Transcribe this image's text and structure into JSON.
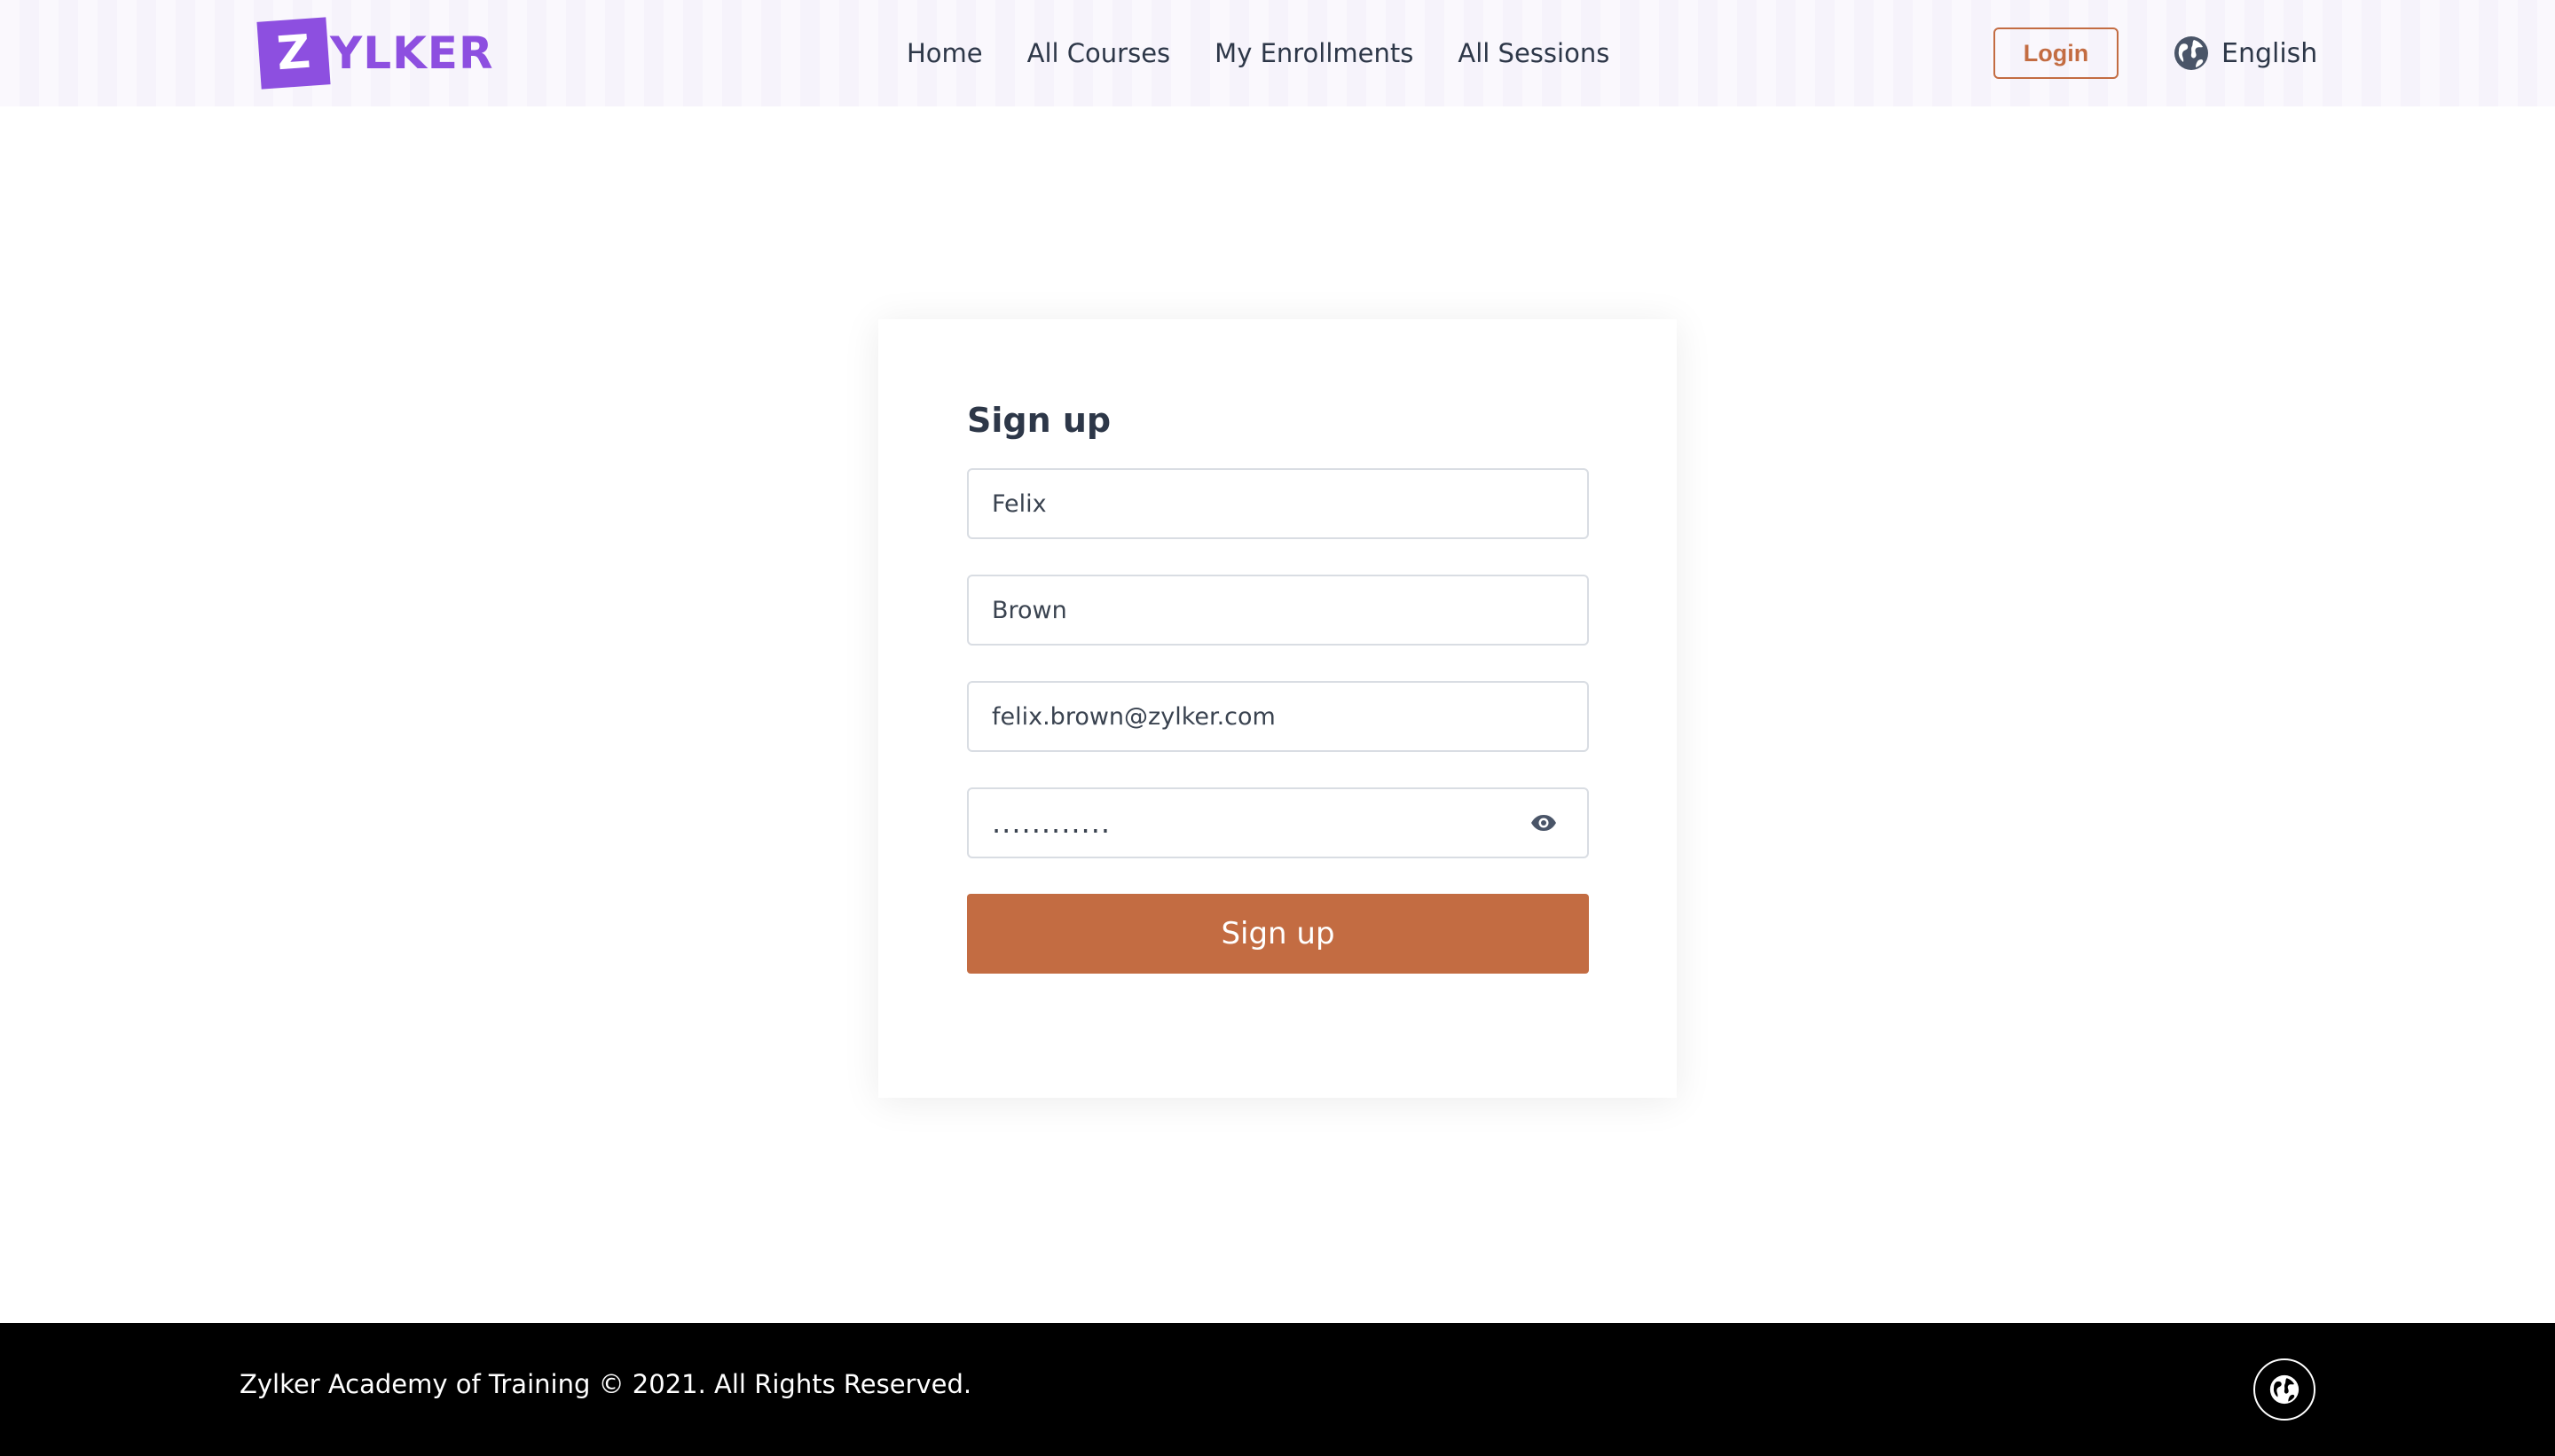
{
  "header": {
    "logo_letter": "Z",
    "logo_text": "YLKER",
    "nav": [
      {
        "label": "Home"
      },
      {
        "label": "All Courses"
      },
      {
        "label": "My Enrollments"
      },
      {
        "label": "All Sessions"
      }
    ],
    "login_label": "Login",
    "language_label": "English"
  },
  "form": {
    "title": "Sign up",
    "first_name": "Felix",
    "last_name": "Brown",
    "email": "felix.brown@zylker.com",
    "password": "............",
    "submit_label": "Sign up"
  },
  "footer": {
    "copyright": "Zylker Academy of Training © 2021. All Rights Reserved."
  },
  "colors": {
    "brand_purple": "#8d4fe0",
    "accent_orange": "#c36c42",
    "footer_bg": "#000000"
  },
  "icons": {
    "language": "globe-icon",
    "password_toggle": "eye-icon",
    "footer_language": "globe-icon"
  }
}
